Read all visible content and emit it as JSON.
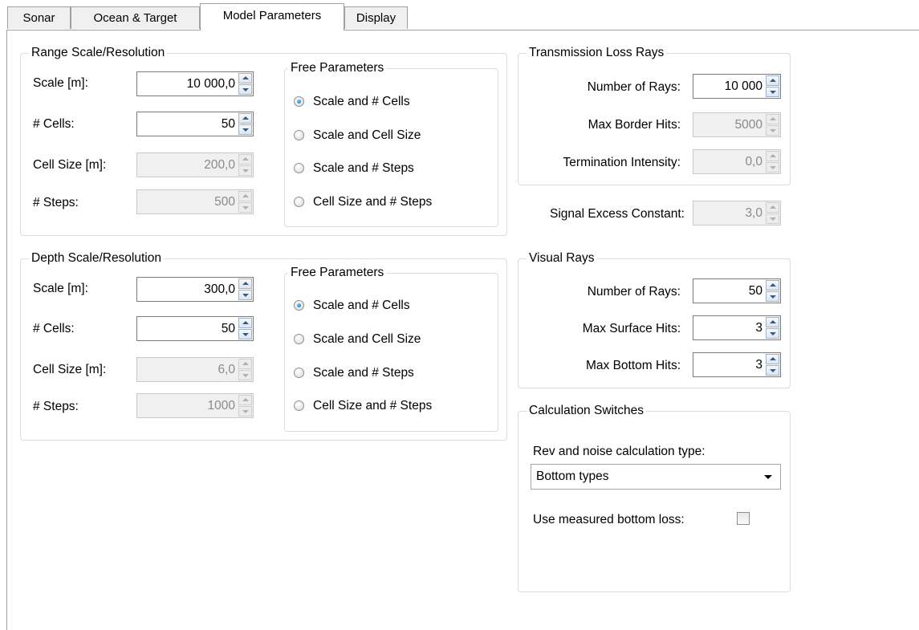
{
  "tabs": [
    {
      "label": "Sonar"
    },
    {
      "label": "Ocean & Target"
    },
    {
      "label": "Model Parameters"
    },
    {
      "label": "Display"
    }
  ],
  "range": {
    "title": "Range Scale/Resolution",
    "scale_label": "Scale [m]:",
    "scale_value": "10 000,0",
    "cells_label": "# Cells:",
    "cells_value": "50",
    "cellsize_label": "Cell Size [m]:",
    "cellsize_value": "200,0",
    "steps_label": "# Steps:",
    "steps_value": "500",
    "free": {
      "title": "Free Parameters",
      "options": [
        "Scale and # Cells",
        "Scale and Cell Size",
        "Scale and # Steps",
        "Cell Size and # Steps"
      ],
      "selected": "Scale and # Cells"
    }
  },
  "depth": {
    "title": "Depth Scale/Resolution",
    "scale_label": "Scale [m]:",
    "scale_value": "300,0",
    "cells_label": "# Cells:",
    "cells_value": "50",
    "cellsize_label": "Cell Size [m]:",
    "cellsize_value": "6,0",
    "steps_label": "# Steps:",
    "steps_value": "1000",
    "free": {
      "title": "Free Parameters",
      "options": [
        "Scale and # Cells",
        "Scale and Cell Size",
        "Scale and # Steps",
        "Cell Size and # Steps"
      ],
      "selected": "Scale and # Cells"
    }
  },
  "tl_rays": {
    "title": "Transmission Loss Rays",
    "num_rays_label": "Number of Rays:",
    "num_rays_value": "10 000",
    "border_hits_label": "Max Border Hits:",
    "border_hits_value": "5000",
    "term_label": "Termination Intensity:",
    "term_value": "0,0"
  },
  "signal_excess": {
    "label": "Signal Excess Constant:",
    "value": "3,0"
  },
  "visual_rays": {
    "title": "Visual Rays",
    "num_rays_label": "Number of Rays:",
    "num_rays_value": "50",
    "surface_label": "Max Surface Hits:",
    "surface_value": "3",
    "bottom_label": "Max Bottom Hits:",
    "bottom_value": "3"
  },
  "calc": {
    "title": "Calculation Switches",
    "type_label": "Rev and noise calculation type:",
    "type_value": "Bottom types",
    "measured_label": "Use measured bottom loss:",
    "measured_checked": false
  },
  "colors": {
    "accent": "#0d5c9c",
    "border": "#dcdcdc",
    "disabled_bg": "#f0f0f0"
  }
}
